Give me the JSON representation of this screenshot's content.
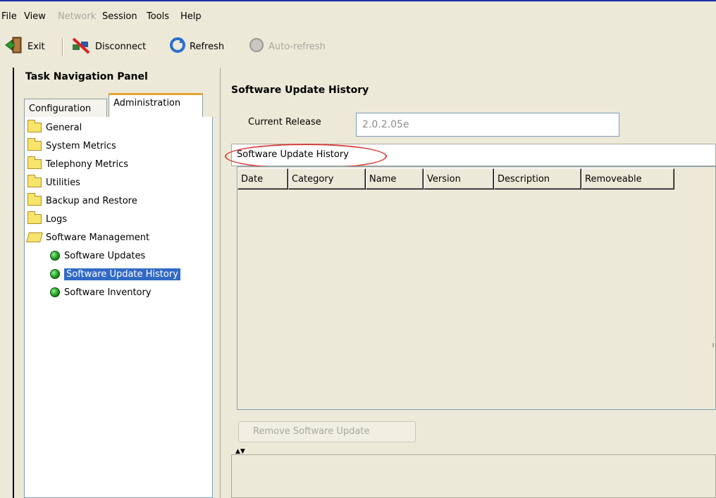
{
  "menubar": {
    "items": [
      {
        "label": "File",
        "enabled": true
      },
      {
        "label": "View",
        "enabled": true
      },
      {
        "label": "Network",
        "enabled": false
      },
      {
        "label": "Session",
        "enabled": true
      },
      {
        "label": "Tools",
        "enabled": true
      },
      {
        "label": "Help",
        "enabled": true
      }
    ]
  },
  "toolbar": {
    "exit_label": "Exit",
    "disconnect_label": "Disconnect",
    "refresh_label": "Refresh",
    "autorefresh_label": "Auto-refresh"
  },
  "nav_panel": {
    "title": "Task Navigation Panel",
    "tabs": [
      {
        "label": "Configuration",
        "active": false
      },
      {
        "label": "Administration",
        "active": true
      }
    ],
    "tree": [
      {
        "label": "General",
        "icon": "folder-icon"
      },
      {
        "label": "System Metrics",
        "icon": "folder-icon"
      },
      {
        "label": "Telephony Metrics",
        "icon": "folder-icon"
      },
      {
        "label": "Utilities",
        "icon": "folder-icon"
      },
      {
        "label": "Backup and Restore",
        "icon": "folder-icon"
      },
      {
        "label": "Logs",
        "icon": "folder-icon"
      },
      {
        "label": "Software Management",
        "icon": "folder-open-icon"
      },
      {
        "label": "Software Updates",
        "icon": "green-dot-icon"
      },
      {
        "label": "Software Update History",
        "icon": "green-dot-icon",
        "selected": true
      },
      {
        "label": "Software Inventory",
        "icon": "green-dot-icon"
      }
    ]
  },
  "content": {
    "title": "Software Update History",
    "current_release_label": "Current Release",
    "current_release_value": "2.0.2.05e",
    "history_label": "Software Update History",
    "table_columns": [
      "Date",
      "Category",
      "Name",
      "Version",
      "Description",
      "Removeable"
    ],
    "remove_button_label": "Remove Software Update"
  },
  "colors": {
    "selection": "#316ac5",
    "annotation_circle": "#d94040",
    "active_tab_accent": "#e6a430"
  }
}
